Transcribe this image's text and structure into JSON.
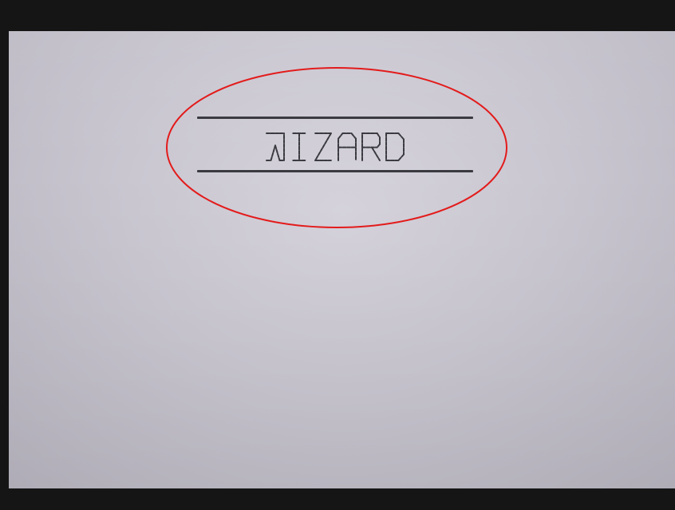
{
  "display": {
    "title": "WIZARD"
  },
  "colors": {
    "bezel": "#151515",
    "screen": "#cac7d1",
    "segment": "#3a3a40",
    "highlight": "#e31b1b"
  }
}
